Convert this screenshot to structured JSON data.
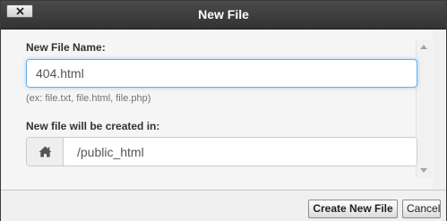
{
  "dialog": {
    "title": "New File",
    "close_icon": "close-x-icon"
  },
  "form": {
    "file_name_label": "New File Name:",
    "file_name_value": "404.html",
    "file_name_hint": "(ex: file.txt, file.html, file.php)",
    "location_label": "New file will be created in:",
    "location_icon": "home-icon",
    "location_value": "/public_html"
  },
  "buttons": {
    "create_label": "Create New File",
    "cancel_label": "Cancel"
  },
  "colors": {
    "titlebar": "#333333",
    "focus_border": "#66afe9"
  }
}
